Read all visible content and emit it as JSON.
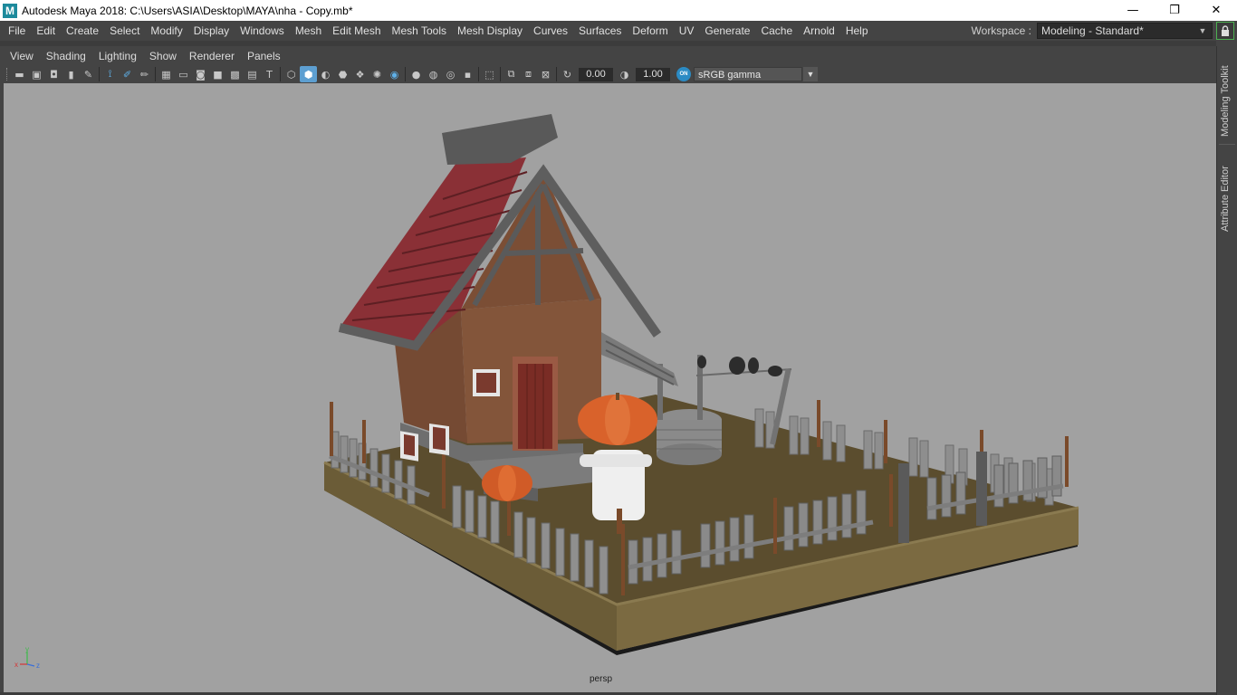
{
  "window": {
    "title": "Autodesk Maya 2018: C:\\Users\\ASIA\\Desktop\\MAYA\\nha - Copy.mb*",
    "logo_letter": "M",
    "controls": {
      "minimize": "—",
      "restore": "❐",
      "close": "✕"
    }
  },
  "menubar": {
    "items": [
      "File",
      "Edit",
      "Create",
      "Select",
      "Modify",
      "Display",
      "Windows",
      "Mesh",
      "Edit Mesh",
      "Mesh Tools",
      "Mesh Display",
      "Curves",
      "Surfaces",
      "Deform",
      "UV",
      "Generate",
      "Cache",
      "Arnold",
      "Help"
    ],
    "workspace_label": "Workspace :",
    "workspace_value": "Modeling - Standard*"
  },
  "panel_menu": {
    "items": [
      "View",
      "Shading",
      "Lighting",
      "Show",
      "Renderer",
      "Panels"
    ]
  },
  "panel_toolbar": {
    "exposure": "0.00",
    "gamma": "1.00",
    "color_space": "sRGB gamma",
    "gamma_toggle_label": "ON"
  },
  "viewport": {
    "camera": "persp",
    "background": "#a1a1a1",
    "axis": {
      "x": "x",
      "y": "y",
      "z": "z"
    }
  },
  "right_tabs": [
    "Modeling Toolkit",
    "Attribute Editor"
  ],
  "colors": {
    "accent": "#5d9fd1",
    "roof": "#8a3036",
    "walls": "#7a4b34",
    "ground": "#5a4b2e",
    "base": "#7d6b43",
    "pumpkin": "#d9622b",
    "fence": "#8e8e8e"
  }
}
